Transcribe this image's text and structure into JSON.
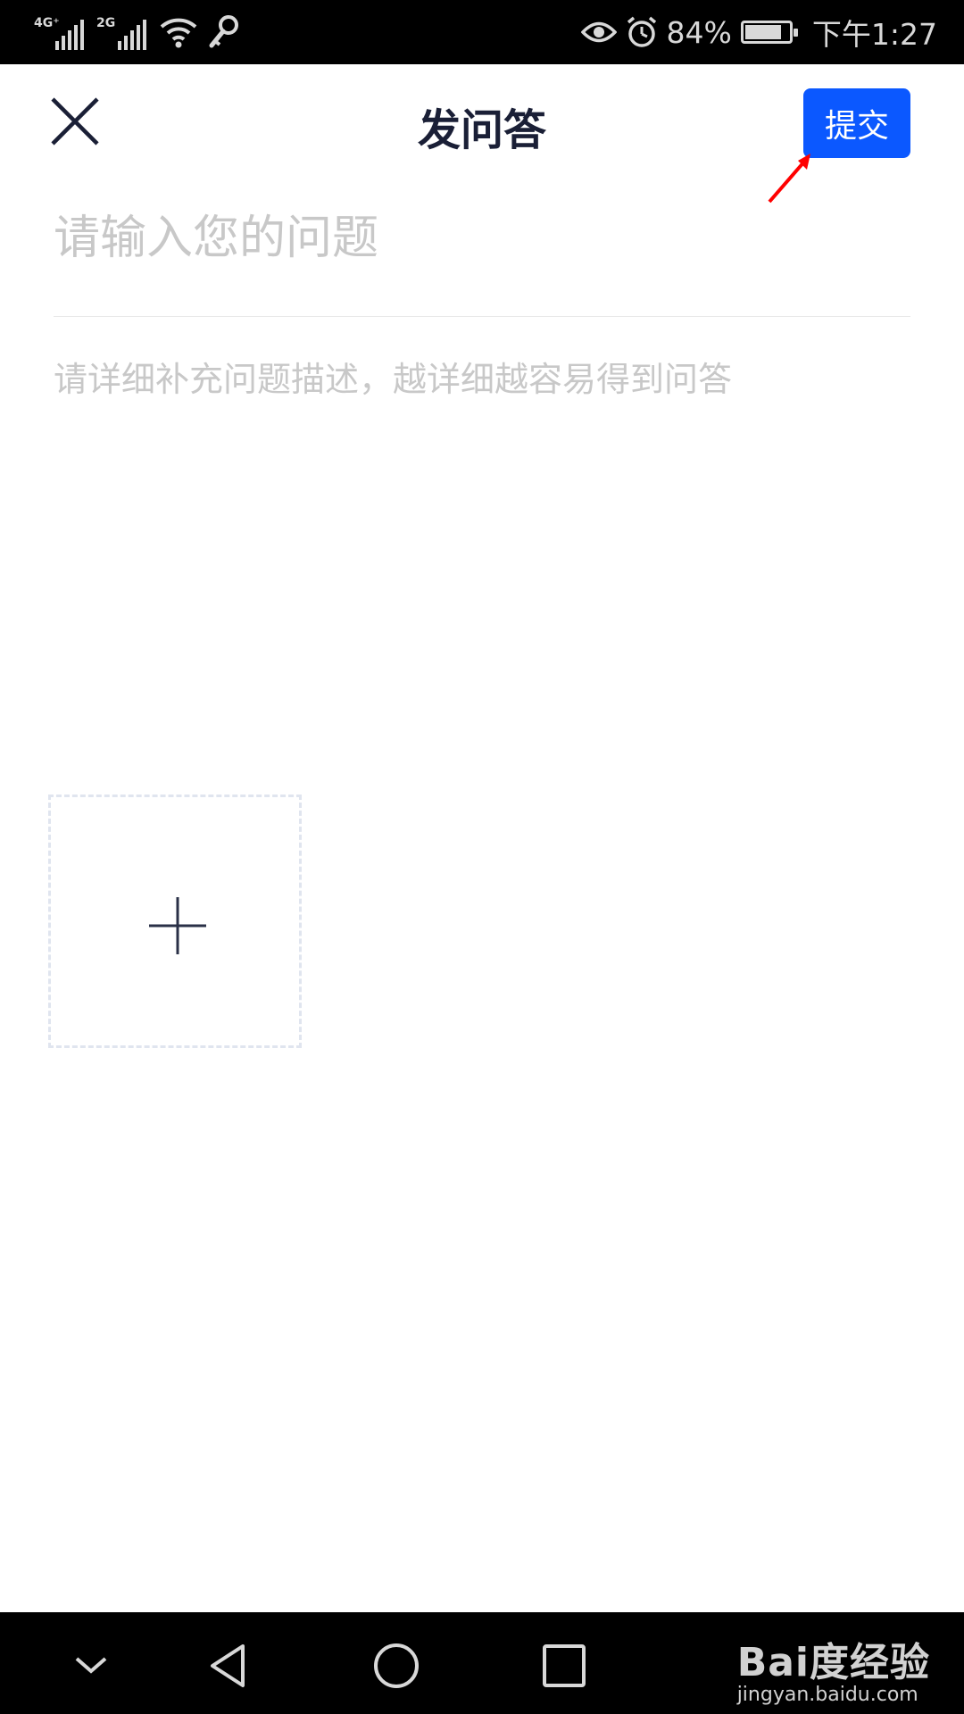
{
  "status_bar": {
    "network_1": "4G⁺",
    "network_2": "2G",
    "battery_percent": "84%",
    "battery_level": 0.84,
    "time": "下午1:27",
    "icons": [
      "signal-4g-icon",
      "signal-2g-icon",
      "wifi-icon",
      "key-icon",
      "eye-icon",
      "alarm-icon",
      "battery-icon"
    ]
  },
  "header": {
    "title": "发问答",
    "close_icon": "close-icon",
    "submit_label": "提交"
  },
  "form": {
    "question_placeholder": "请输入您的问题",
    "question_value": "",
    "description_placeholder": "请详细补充问题描述，越详细越容易得到问答",
    "description_value": "",
    "add_image_icon": "plus-icon"
  },
  "annotation": {
    "arrow_color": "#ff0000"
  },
  "nav_bar": {
    "icons": [
      "chevron-down-icon",
      "back-icon",
      "home-icon",
      "recents-icon"
    ]
  },
  "watermark": {
    "logo": "Bai度经验",
    "url": "jingyan.baidu.com"
  },
  "colors": {
    "accent": "#0b58ff",
    "title": "#1a1f36",
    "placeholder": "#c8c8c8"
  }
}
